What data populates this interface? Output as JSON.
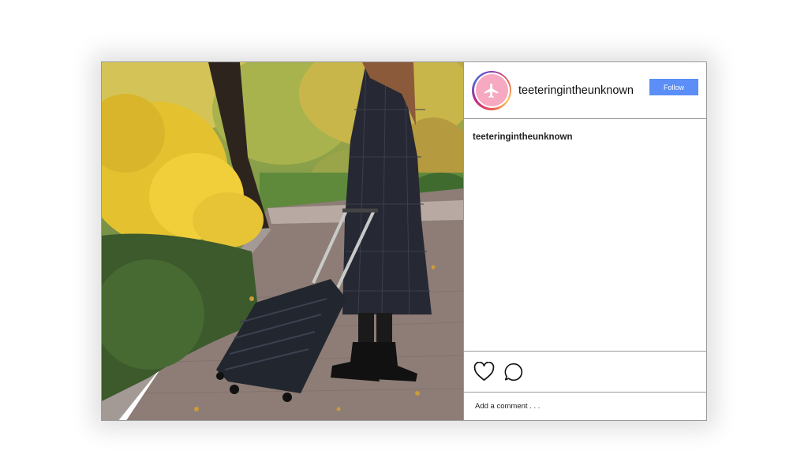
{
  "post": {
    "image_alt": "",
    "header": {
      "username": "teeteringintheunknown",
      "avatar_icon": "airplane-icon",
      "avatar_color": "#f6a9c0",
      "follow_label": "Follow",
      "follow_color": "#5b8ff7"
    },
    "caption": {
      "username": "teeteringintheunknown"
    },
    "actions": {
      "like_icon": "heart-icon",
      "comment_icon": "comment-bubble-icon"
    },
    "comment_box": {
      "placeholder": "Add a comment . . ."
    }
  }
}
